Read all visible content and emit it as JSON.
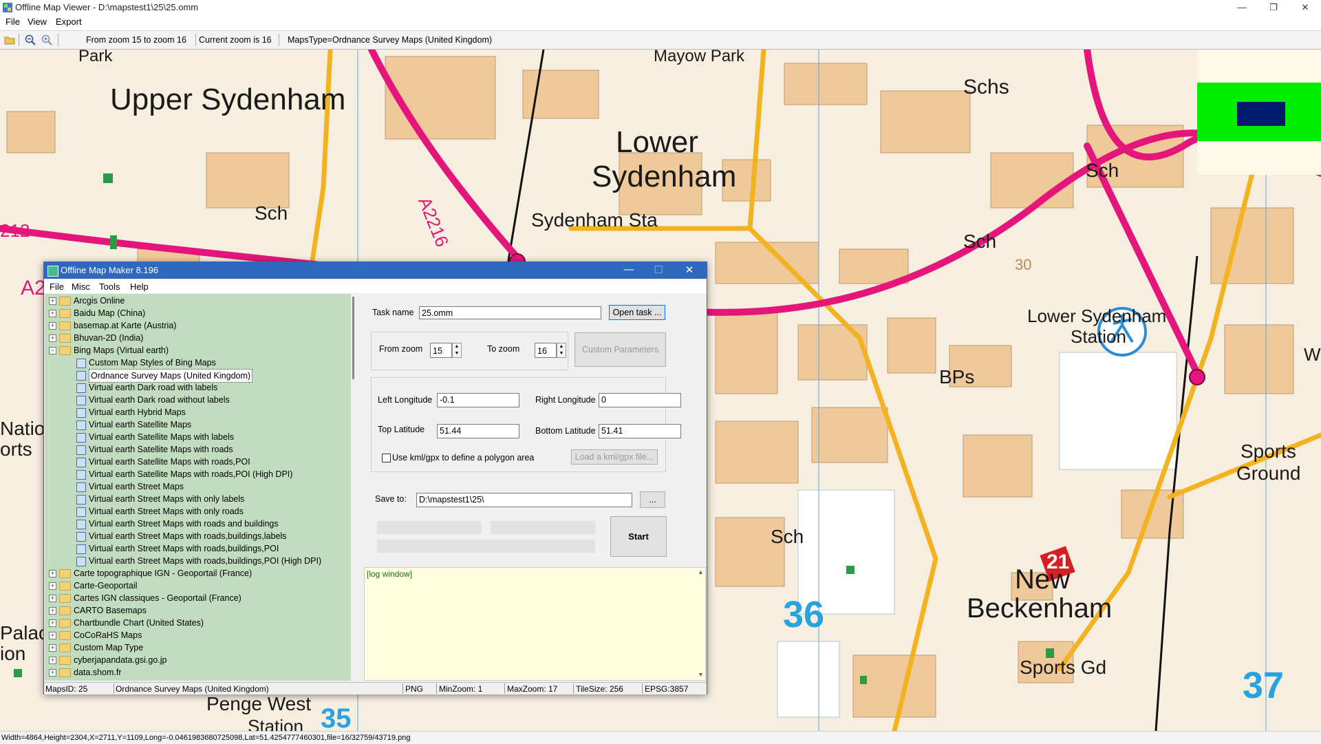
{
  "window": {
    "title": "Offline Map Viewer - D:\\mapstest1\\25\\25.omm",
    "controls": {
      "minimize": "—",
      "restore": "❐",
      "close": "✕"
    }
  },
  "menu": [
    "File",
    "View",
    "Export"
  ],
  "toolbar": {
    "zoom_range": "From zoom 15 to zoom 16",
    "current_zoom": "Current zoom is 16",
    "maps_type": "MapsType=Ordnance Survey Maps (United Kingdom)"
  },
  "map": {
    "labels": {
      "upper_sydenham": "Upper Sydenham",
      "lower": "Lower",
      "sydenham": "Sydenham",
      "sydenham_sta": "Sydenham Sta",
      "lower_sydenham": "Lower Sydenham",
      "station": "Station",
      "new": "New",
      "beckenham": "Beckenham",
      "sports_gd": "Sports Gd",
      "sports": "Sports",
      "ground": "Ground",
      "penge_west": "Penge West",
      "station2": "Station",
      "schs": "Schs",
      "sch1": "Sch",
      "sch2": "Sch",
      "sch3": "Sch",
      "sch4": "Sch",
      "sch5": "Sch",
      "bps": "BPs",
      "road_a2216": "A2216",
      "road_212": "212",
      "grid_36": "36",
      "grid_37": "37",
      "grid_35": "35",
      "badge_21": "21",
      "natio": "Natio",
      "orts": "orts",
      "palac": "Palac",
      "ion": "ion",
      "park1": "Park",
      "park2": "Mayow Park",
      "a2_left": "A2",
      "w_edge": "W",
      "number_30": "30"
    },
    "overlay_colors": {
      "green": "#00ee00",
      "navy": "#001a6e",
      "cream": "#fdf8e8"
    }
  },
  "status_bar": "Width=4864,Height=2304,X=2711,Y=1109,Long=-0.0461983680725098,Lat=51.4254777460301,file=16/32759/43719.png",
  "dialog": {
    "title": "Offline Map Maker 8.196",
    "controls": {
      "minimize": "—",
      "maximize": "☐",
      "close": "✕"
    },
    "menu": [
      "File",
      "Misc",
      "Tools",
      "Help"
    ],
    "tree": {
      "top_items_before": [
        "Arcgis Online",
        "Baidu Map (China)",
        "basemap.at Karte (Austria)",
        "Bhuvan-2D (India)"
      ],
      "expanded_folder": "Bing Maps (Virtual earth)",
      "children": [
        "Custom Map Styles of Bing Maps",
        "Ordnance Survey Maps (United Kingdom)",
        "Virtual earth Dark road with labels",
        "Virtual earth Dark road without labels",
        "Virtual earth Hybrid Maps",
        "Virtual earth Satellite Maps",
        "Virtual earth Satellite Maps with labels",
        "Virtual earth Satellite Maps with roads",
        "Virtual earth Satellite Maps with roads,POI",
        "Virtual earth Satellite Maps with roads,POI (High DPI)",
        "Virtual earth Street Maps",
        "Virtual earth Street Maps with only labels",
        "Virtual earth Street Maps with only roads",
        "Virtual earth Street Maps with roads and buildings",
        "Virtual earth Street Maps with roads,buildings,labels",
        "Virtual earth Street Maps with roads,buildings,POI",
        "Virtual earth Street Maps with roads,buildings,POI (High DPI)"
      ],
      "selected": "Ordnance Survey Maps (United Kingdom)",
      "top_items_after": [
        "Carte topographique IGN - Geoportail (France)",
        "Carte-Geoportail",
        "Cartes IGN classiques - Geoportail (France)",
        "CARTO Basemaps",
        "Chartbundle Chart (United States)",
        "CoCoRaHS Maps",
        "Custom Map Type",
        "cyberjapandata.gsi.go.jp",
        "data.shom.fr"
      ]
    },
    "form": {
      "task_name_label": "Task name",
      "task_name_value": "25.omm",
      "open_task_button": "Open task ...",
      "from_zoom_label": "From zoom",
      "from_zoom_value": "15",
      "to_zoom_label": "To zoom",
      "to_zoom_value": "16",
      "custom_params_button": "Custom Parameters",
      "left_lon_label": "Left Longitude",
      "left_lon_value": "-0.1",
      "right_lon_label": "Right Longitude",
      "right_lon_value": "0",
      "top_lat_label": "Top Latitude",
      "top_lat_value": "51.44",
      "bottom_lat_label": "Bottom Latitude",
      "bottom_lat_value": "51.41",
      "kml_checkbox_label": "Use kml/gpx to define a polygon area",
      "kml_checked": false,
      "load_kml_button": "Load a kml/gpx file...",
      "save_to_label": "Save to:",
      "save_to_value": "D:\\mapstest1\\25\\",
      "browse_button": "...",
      "start_button": "Start"
    },
    "log": {
      "header": "[log window]"
    },
    "status": {
      "maps_id": "MapsID: 25",
      "maps_name": "Ordnance Survey Maps (United Kingdom)",
      "format": "PNG",
      "min_zoom": "MinZoom: 1",
      "max_zoom": "MaxZoom: 17",
      "tile_size": "TileSize: 256",
      "epsg": "EPSG:3857"
    }
  }
}
